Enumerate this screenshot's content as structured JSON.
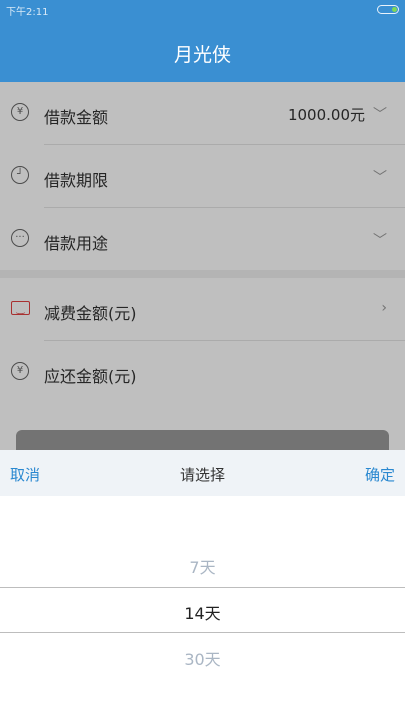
{
  "status": {
    "time": "下午2:11"
  },
  "header": {
    "title": "月光侠"
  },
  "form": {
    "amount": {
      "label": "借款金额",
      "value": "1000.00元",
      "icon": "yen-circle-icon"
    },
    "term": {
      "label": "借款期限",
      "icon": "clock-icon"
    },
    "purpose": {
      "label": "借款用途",
      "icon": "more-circle-icon"
    },
    "fee": {
      "label": "减费金额(元)",
      "icon": "envelope-icon"
    },
    "repay": {
      "label": "应还金额(元)",
      "icon": "yen-circle-icon"
    }
  },
  "picker": {
    "cancel": "取消",
    "title": "请选择",
    "confirm": "确定",
    "options": [
      "7天",
      "14天",
      "30天"
    ],
    "selected": "14天"
  },
  "colors": {
    "brand": "#3a8fd2",
    "link": "#2a88d0",
    "fee_icon": "#e04040"
  }
}
